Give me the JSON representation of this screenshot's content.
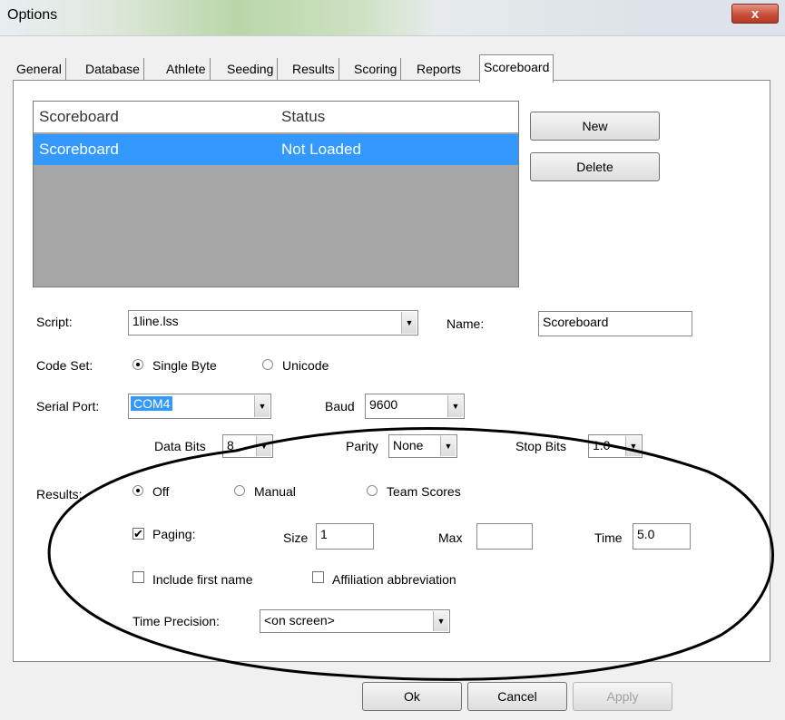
{
  "window": {
    "title": "Options",
    "close_glyph": "x"
  },
  "tabs": [
    "General",
    "Database",
    "Athlete",
    "Seeding",
    "Results",
    "Scoring",
    "Reports",
    "Scoreboard"
  ],
  "active_tab": "Scoreboard",
  "scoreboard_list": {
    "headers": [
      "Scoreboard",
      "Status"
    ],
    "rows": [
      {
        "name": "Scoreboard",
        "status": "Not Loaded"
      }
    ]
  },
  "buttons": {
    "new": "New",
    "delete": "Delete",
    "ok": "Ok",
    "cancel": "Cancel",
    "apply": "Apply"
  },
  "script": {
    "label": "Script:",
    "value": "1line.lss"
  },
  "name": {
    "label": "Name:",
    "value": "Scoreboard"
  },
  "code_set": {
    "label": "Code Set:",
    "options": [
      "Single Byte",
      "Unicode"
    ],
    "selected": "Single Byte"
  },
  "serial_port": {
    "label": "Serial Port:",
    "value": "COM4"
  },
  "baud": {
    "label": "Baud",
    "value": "9600"
  },
  "data_bits": {
    "label": "Data Bits",
    "value": "8"
  },
  "parity": {
    "label": "Parity",
    "value": "None"
  },
  "stop_bits": {
    "label": "Stop Bits",
    "value": "1.0"
  },
  "results": {
    "label": "Results:",
    "options": [
      "Off",
      "Manual",
      "Team Scores"
    ],
    "selected": "Off"
  },
  "paging": {
    "label": "Paging:",
    "checked": true,
    "check_glyph": "✔"
  },
  "size": {
    "label": "Size",
    "value": "1"
  },
  "max": {
    "label": "Max",
    "value": ""
  },
  "time": {
    "label": "Time",
    "value": "5.0"
  },
  "include_first_name": {
    "label": "Include first name",
    "checked": false
  },
  "affiliation_abbreviation": {
    "label": "Affiliation abbreviation",
    "checked": false
  },
  "time_precision": {
    "label": "Time Precision:",
    "value": "<on screen>"
  },
  "dropdown_glyph": "▼",
  "colors": {
    "selection": "#3399ff",
    "list_background": "#a6a6a6",
    "close_button": "#c8503a"
  }
}
